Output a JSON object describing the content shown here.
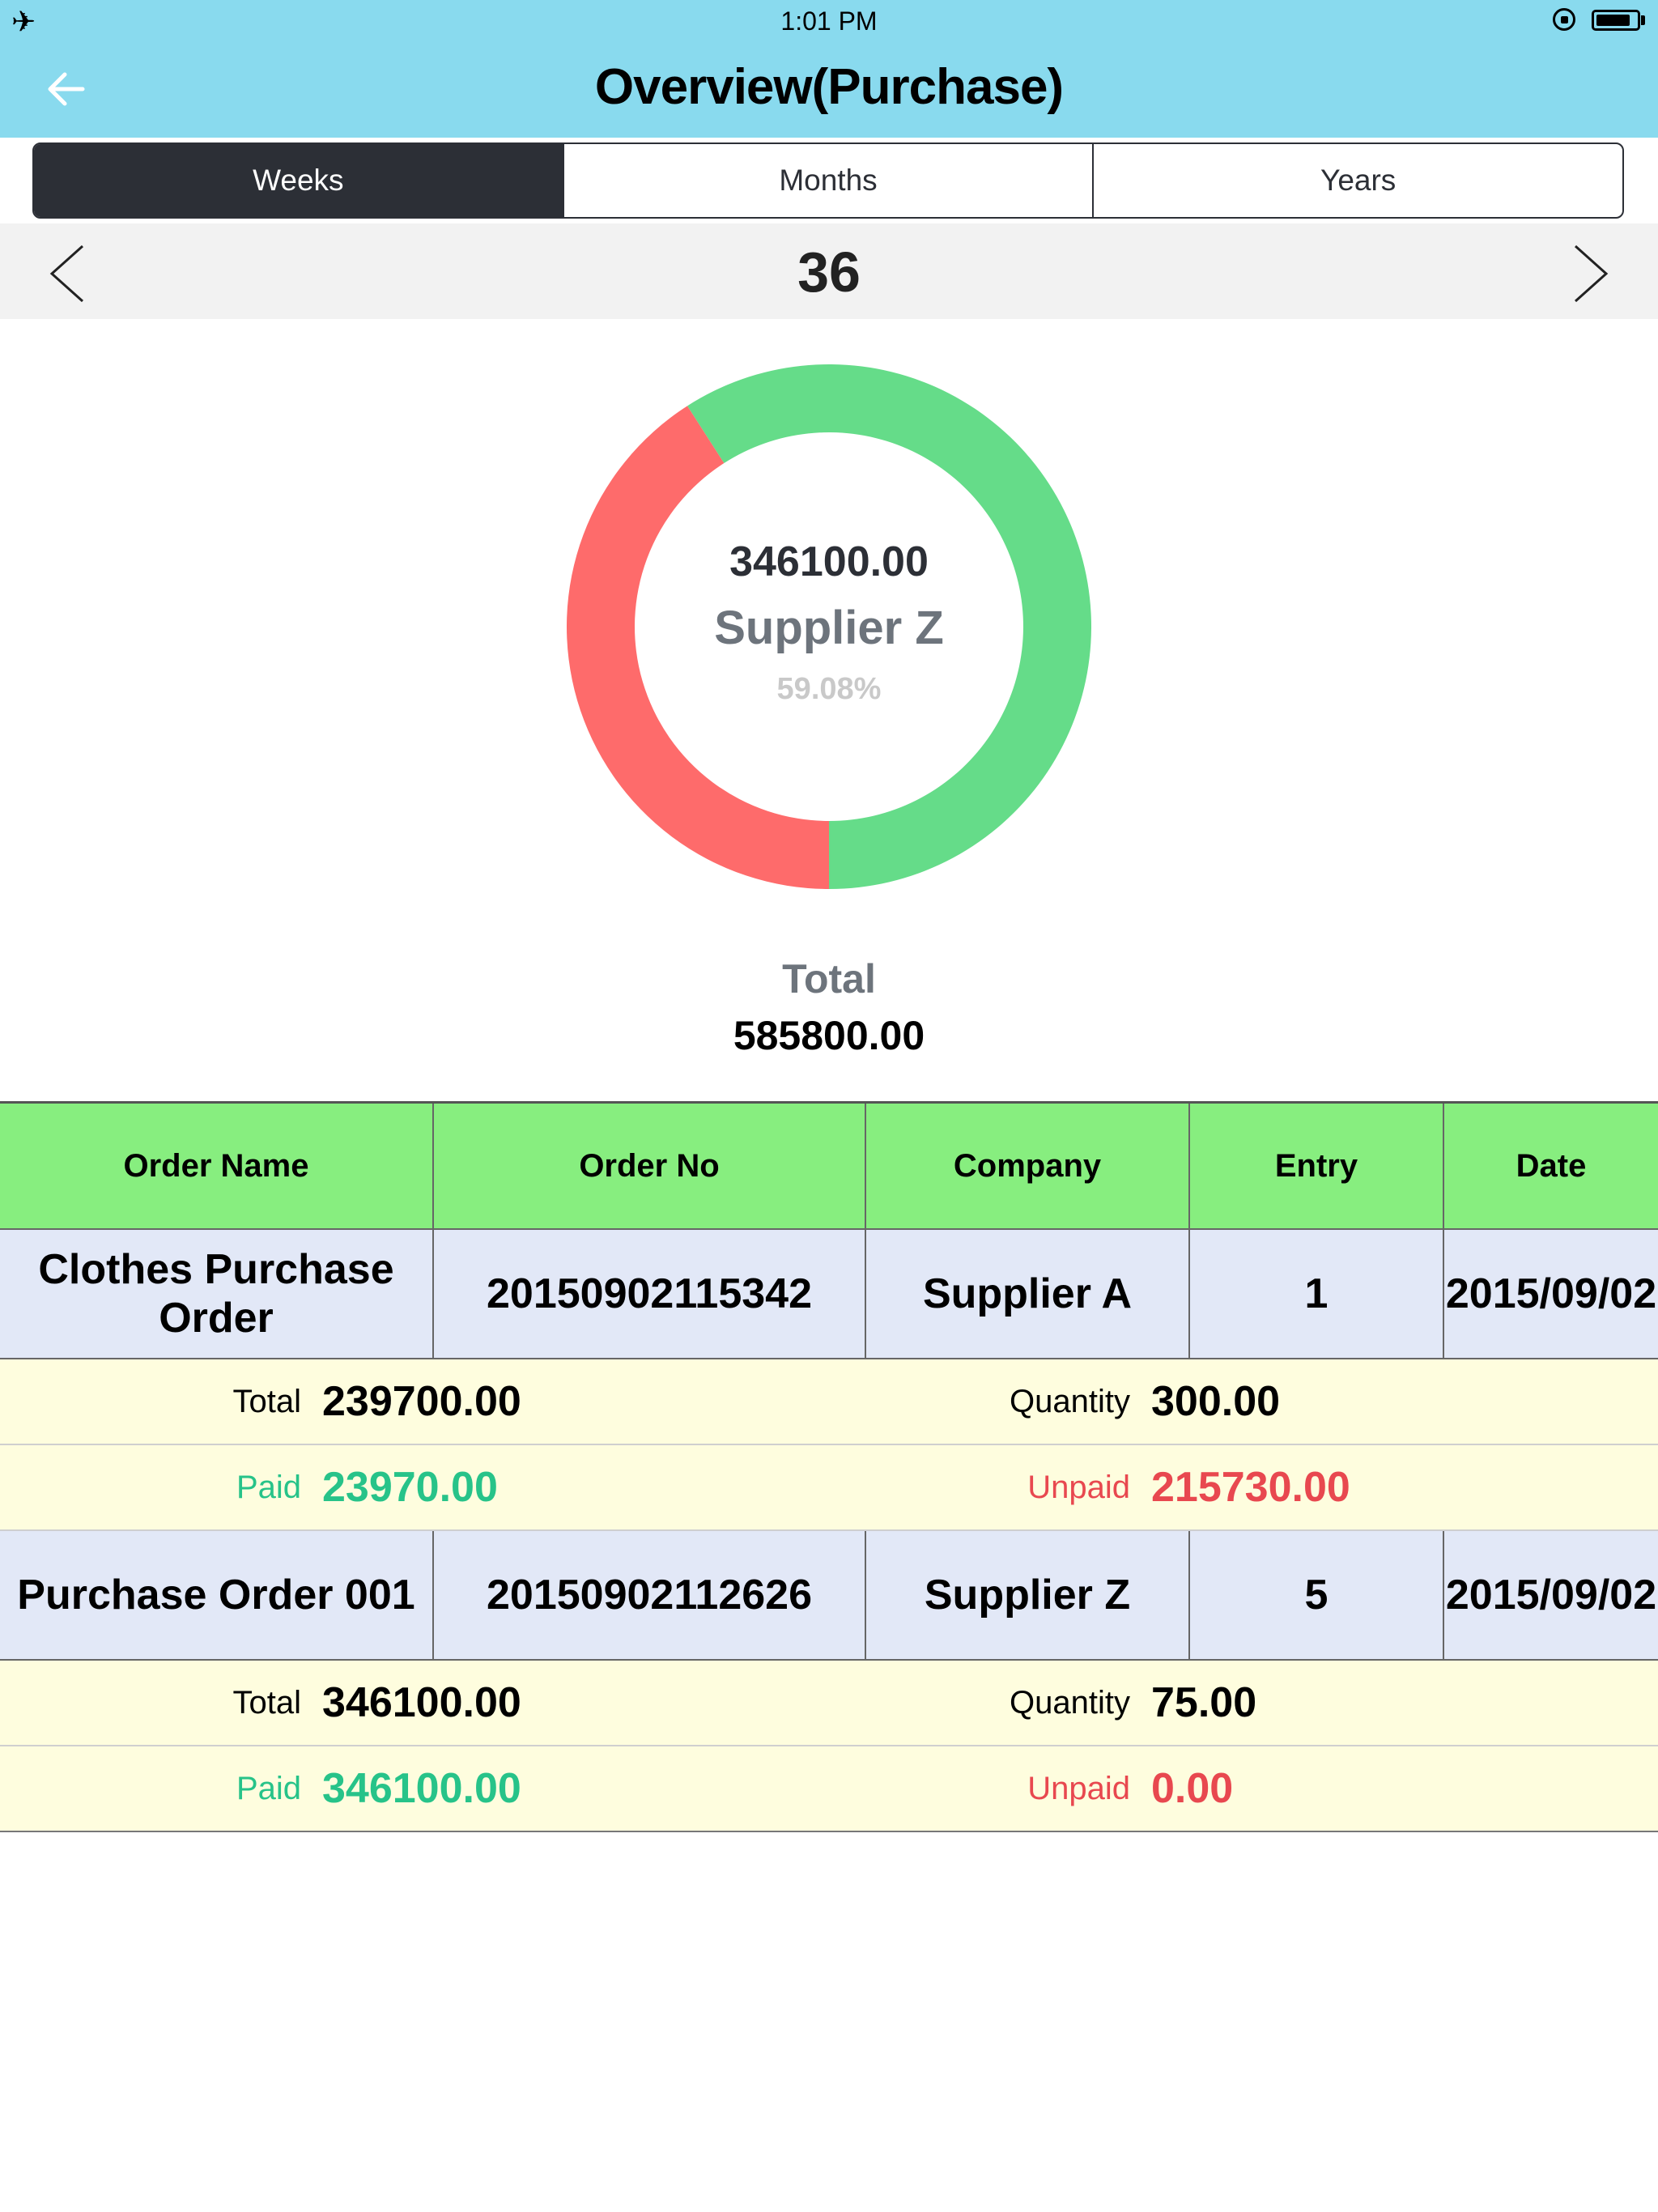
{
  "status_bar": {
    "time": "1:01 PM",
    "battery_level": 0.85
  },
  "header": {
    "title": "Overview(Purchase)"
  },
  "period_tabs": [
    "Weeks",
    "Months",
    "Years"
  ],
  "active_tab": "Weeks",
  "week_nav": {
    "value": "36"
  },
  "chart_data": {
    "type": "pie",
    "style": "donut",
    "slices": [
      {
        "label": "Supplier Z",
        "value": 346100.0,
        "percent": 59.08,
        "color": "#65dc89"
      },
      {
        "label": "Supplier A",
        "value": 239700.0,
        "percent": 40.92,
        "color": "#fe6b6b"
      }
    ],
    "center": {
      "value": "346100.00",
      "label": "Supplier Z",
      "percent": "59.08%"
    }
  },
  "total": {
    "label": "Total",
    "value": "585800.00"
  },
  "table": {
    "headers": [
      "Order Name",
      "Order No",
      "Company",
      "Entry",
      "Date"
    ],
    "orders": [
      {
        "name": "Clothes Purchase Order",
        "order_no": "20150902115342",
        "company": "Supplier A",
        "entry": "1",
        "date": "2015/09/02",
        "total_label": "Total",
        "total": "239700.00",
        "quantity_label": "Quantity",
        "quantity": "300.00",
        "paid_label": "Paid",
        "paid": "23970.00",
        "unpaid_label": "Unpaid",
        "unpaid": "215730.00"
      },
      {
        "name": "Purchase Order 001",
        "order_no": "20150902112626",
        "company": "Supplier Z",
        "entry": "5",
        "date": "2015/09/02",
        "total_label": "Total",
        "total": "346100.00",
        "quantity_label": "Quantity",
        "quantity": "75.00",
        "paid_label": "Paid",
        "paid": "346100.00",
        "unpaid_label": "Unpaid",
        "unpaid": "0.00"
      }
    ]
  }
}
